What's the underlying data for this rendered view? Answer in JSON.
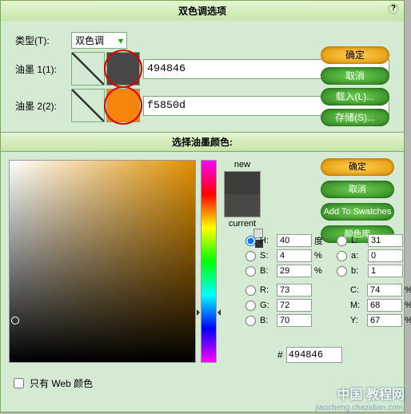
{
  "title": "双色调选项",
  "type": {
    "label": "类型(T):",
    "value": "双色调"
  },
  "ink1": {
    "label": "油墨 1(1):",
    "hex": "494846",
    "color": "#494846"
  },
  "ink2": {
    "label": "油墨 2(2):",
    "hex": "f5850d",
    "color": "#f5850d"
  },
  "buttons": {
    "ok": "确定",
    "cancel": "取消",
    "load": "载入(L)...",
    "save": "存储(S)..."
  },
  "picker": {
    "title": "选择油墨颜色:",
    "new": "new",
    "current": "current",
    "buttons": {
      "ok": "确定",
      "cancel": "取消",
      "add": "Add To Swatches",
      "lib": "颜色库"
    },
    "hsv": {
      "h": "40",
      "s": "4",
      "b": "29"
    },
    "rgb": {
      "r": "73",
      "g": "72",
      "b": "70"
    },
    "lab": {
      "l": "31",
      "a": "0",
      "b2": "1"
    },
    "cmyk": {
      "c": "74",
      "m": "68",
      "y": "67"
    },
    "units": {
      "deg": "度",
      "pct": "%"
    },
    "hex": "494846",
    "web_label": "只有 Web 颜色"
  },
  "watermark": {
    "big": "中国 教程网",
    "url": "jiaocheng.chazidian.com"
  }
}
